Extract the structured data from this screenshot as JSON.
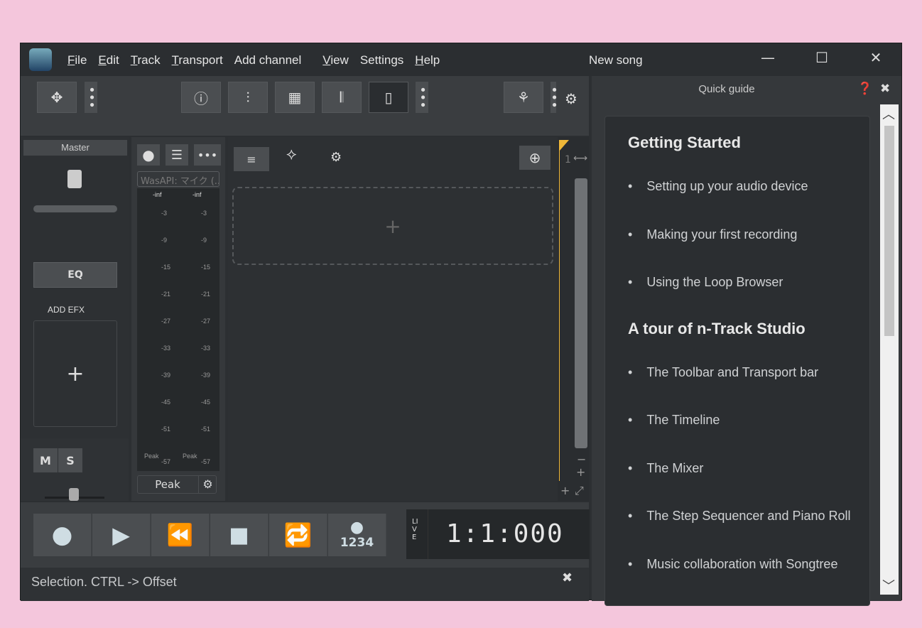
{
  "window": {
    "title": "New song",
    "minimize": "—",
    "maximize": "☐",
    "close": "✕"
  },
  "menu": [
    "File",
    "Edit",
    "Track",
    "Transport",
    "Add channel",
    "View",
    "Settings",
    "Help"
  ],
  "mixer": {
    "master_label": "Master",
    "eq": "EQ",
    "add_efx": "ADD EFX",
    "add": "+",
    "mute": "M",
    "solo": "S"
  },
  "input": {
    "device": "WasAPI: マイク (...",
    "inf_left": "-inf",
    "inf_right": "-inf",
    "scale": [
      "-3",
      "-9",
      "-15",
      "-21",
      "-27",
      "-33",
      "-39",
      "-45",
      "-51",
      "-57"
    ],
    "peak_label": "Peak",
    "peak_button": "Peak"
  },
  "timeline": {
    "add_track": "+",
    "position": "1"
  },
  "transport": {
    "count_in": "1234",
    "live": "LIVE",
    "time": "1:1:000"
  },
  "status": {
    "text": "Selection. CTRL -> Offset"
  },
  "guide": {
    "title": "Quick guide",
    "sections": [
      {
        "heading": "Getting Started",
        "items": [
          "Setting up your audio device",
          "Making your first recording",
          "Using the Loop Browser"
        ]
      },
      {
        "heading": "A tour of n-Track Studio",
        "items": [
          "The Toolbar and Transport bar",
          "The Timeline",
          "The Mixer",
          "The Step Sequencer and Piano Roll",
          "Music collaboration with Songtree"
        ]
      }
    ]
  },
  "colors": {
    "accent": "#f0b838",
    "background": "#2c2f32"
  }
}
